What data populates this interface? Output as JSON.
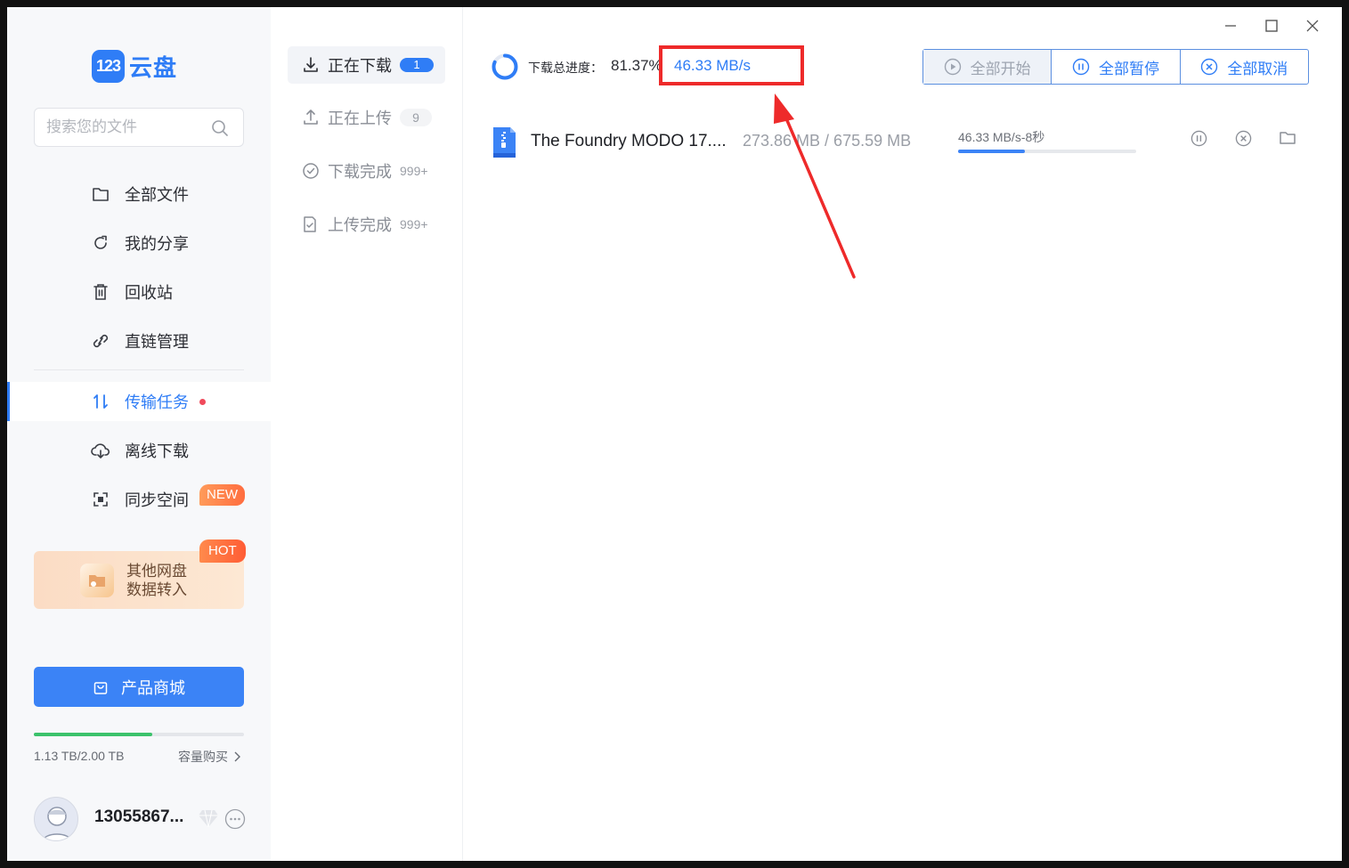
{
  "app": {
    "logo_mark": "123",
    "logo_text": "云盘"
  },
  "sidebar": {
    "search_placeholder": "搜索您的文件",
    "items": [
      {
        "label": "全部文件",
        "icon": "folder-icon"
      },
      {
        "label": "我的分享",
        "icon": "share-icon"
      },
      {
        "label": "回收站",
        "icon": "trash-icon"
      },
      {
        "label": "直链管理",
        "icon": "link-icon"
      },
      {
        "label": "传输任务",
        "icon": "transfer-icon",
        "active": true
      },
      {
        "label": "离线下载",
        "icon": "cloud-download-icon"
      },
      {
        "label": "同步空间",
        "icon": "sync-icon"
      }
    ],
    "new_badge": "NEW",
    "hot_badge": "HOT",
    "promo_line1": "其他网盘",
    "promo_line2": "数据转入",
    "shop_label": "产品商城",
    "storage_text": "1.13 TB/2.00 TB",
    "storage_used_fraction": 0.565,
    "storage_buy": "容量购买",
    "username": "13055867..."
  },
  "tabs": [
    {
      "label": "正在下载",
      "count": "1",
      "active": true
    },
    {
      "label": "正在上传",
      "count": "9"
    },
    {
      "label": "下载完成",
      "count": "999+"
    },
    {
      "label": "上传完成",
      "count": "999+"
    }
  ],
  "main": {
    "progress_label": "下载总进度：",
    "progress_pct": "81.37%",
    "progress_fraction": 0.8137,
    "speed": "46.33 MB/s",
    "buttons": {
      "start_all": "全部开始",
      "pause_all": "全部暂停",
      "cancel_all": "全部取消"
    },
    "task": {
      "file_name": "The Foundry MODO 17....",
      "size": "273.86 MB / 675.59 MB",
      "speed_eta": "46.33 MB/s-8秒",
      "progress_fraction": 0.375
    }
  },
  "colors": {
    "accent": "#2f7df6",
    "highlight": "#ee2a2a",
    "storage": "#3bc26b"
  }
}
